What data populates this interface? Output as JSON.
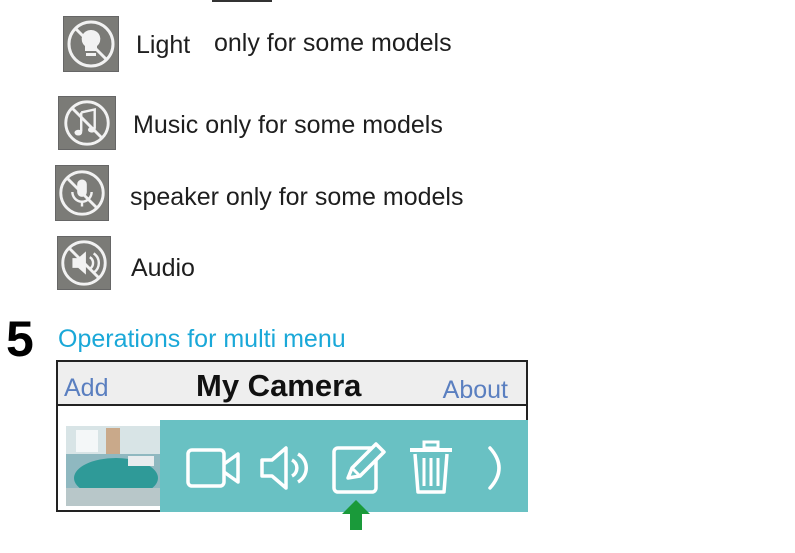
{
  "features": [
    {
      "icon": "lightbulb-disabled-icon",
      "label": "Light",
      "note": "only for some models"
    },
    {
      "icon": "music-disabled-icon",
      "label": "Music only for some models"
    },
    {
      "icon": "microphone-disabled-icon",
      "label": "speaker only for some models"
    },
    {
      "icon": "speaker-volume-disabled-icon",
      "label": "Audio"
    }
  ],
  "section": {
    "number": "5",
    "title": "Operations for multi menu"
  },
  "app": {
    "add_label": "Add",
    "title": "My Camera",
    "about_label": "About",
    "actions": [
      "video-camera-icon",
      "audio-speaker-icon",
      "edit-pencil-icon",
      "trash-icon",
      "chevron-right-icon"
    ]
  },
  "colors": {
    "section_title": "#1aa8d8",
    "header_links": "#5a7fc0",
    "action_bar": "#69c1c3",
    "pointer_arrow": "#1a9a3a"
  }
}
